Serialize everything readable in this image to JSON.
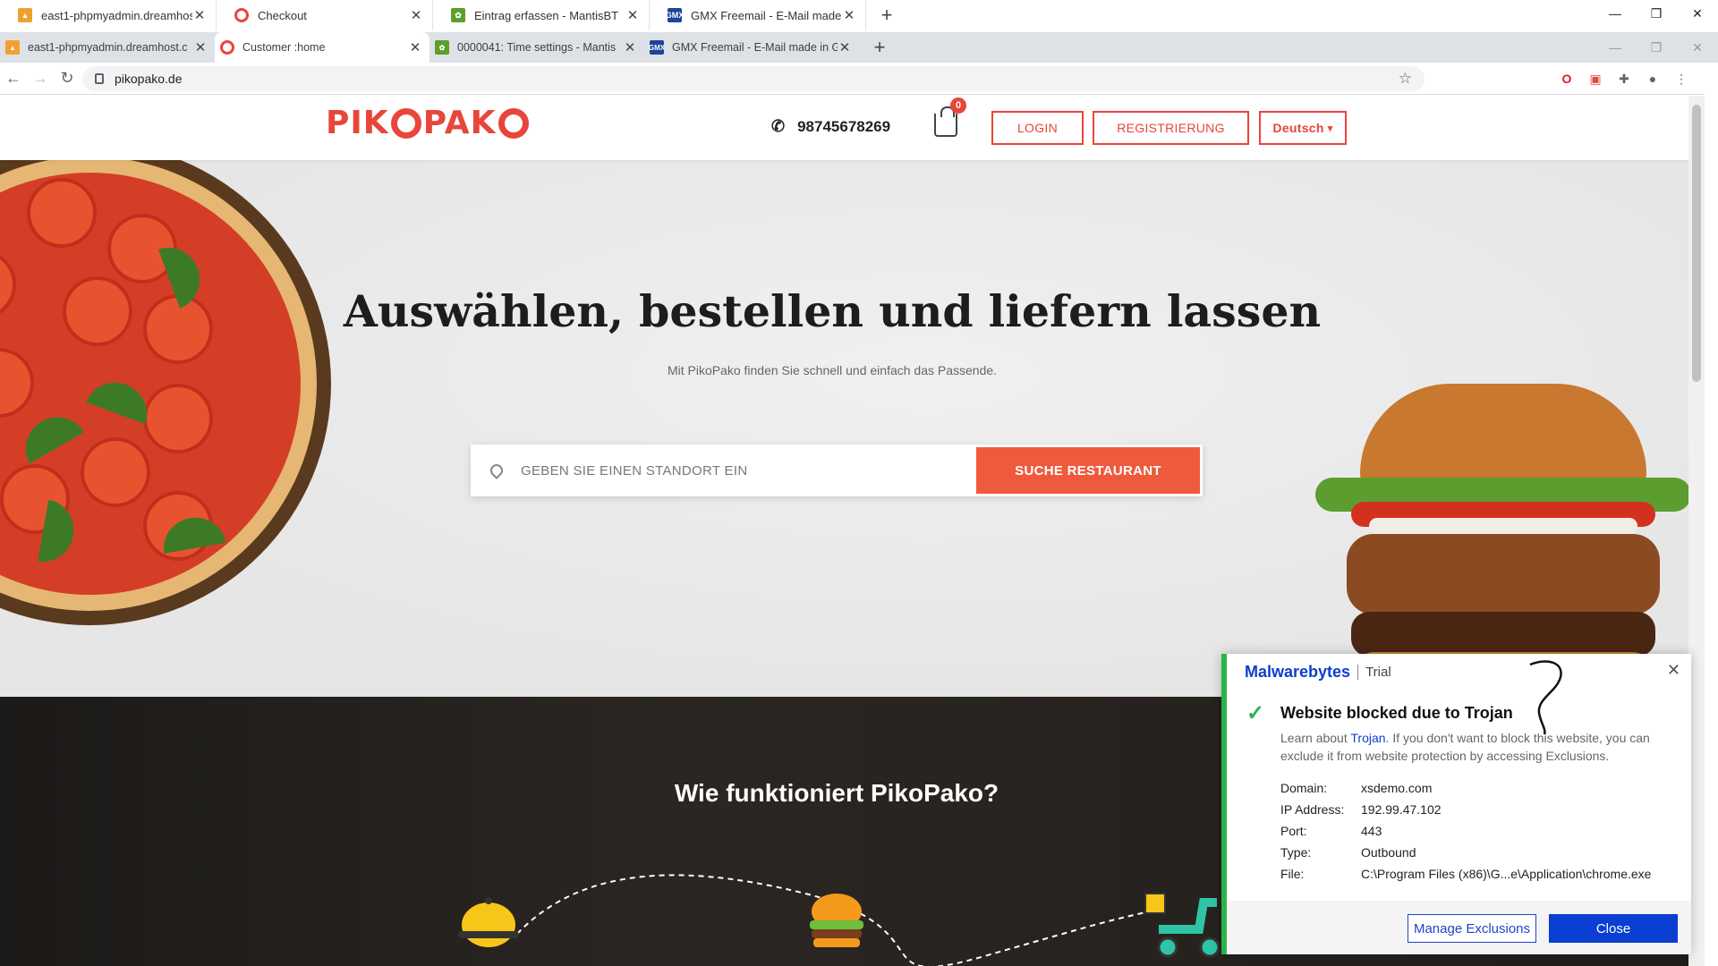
{
  "outer_tabs": [
    {
      "title": "east1-phpmyadmin.dreamhost.c",
      "icon": "phpmyadmin-icon",
      "color": "#f0a030"
    },
    {
      "title": "Checkout",
      "icon": "pikopako-icon",
      "color": "#e8463a"
    },
    {
      "title": "Eintrag erfassen - MantisBT",
      "icon": "mantis-icon",
      "color": "#5aa02c"
    },
    {
      "title": "GMX Freemail - E-Mail made in G",
      "icon": "gmx-icon",
      "color": "#1c449b"
    }
  ],
  "inner_tabs": [
    {
      "title": "east1-phpmyadmin.dreamhost.c",
      "icon": "phpmyadmin-icon",
      "color": "#f0a030",
      "active": false
    },
    {
      "title": "Customer :home",
      "icon": "pikopako-icon",
      "color": "#e8463a",
      "active": true
    },
    {
      "title": "0000041: Time settings - Mantis",
      "icon": "mantis-icon",
      "color": "#5aa02c",
      "active": false
    },
    {
      "title": "GMX Freemail - E-Mail made in G",
      "icon": "gmx-icon",
      "color": "#1c449b",
      "active": false
    }
  ],
  "favicon_texts": {
    "gmx": "GMX"
  },
  "address": {
    "url": "pikopako.de"
  },
  "site": {
    "logo_left": "PIK",
    "logo_right": "PAK",
    "phone": "98745678269",
    "cart_count": "0",
    "login": "LOGIN",
    "register": "REGISTRIERUNG",
    "language": "Deutsch"
  },
  "hero": {
    "title": "Auswählen, bestellen und liefern lassen",
    "subtitle": "Mit PikoPako finden Sie schnell und einfach das Passende.",
    "search_placeholder": "GEBEN SIE EINEN STANDORT EIN",
    "search_button": "SUCHE RESTAURANT"
  },
  "how": {
    "title": "Wie funktioniert PikoPako?"
  },
  "malwarebytes": {
    "brand": "Malwarebytes",
    "trial": "Trial",
    "title": "Website blocked due to Trojan",
    "desc_prefix": "Learn about ",
    "desc_link": "Trojan",
    "desc_suffix": ". If you don't want to block this website, you can exclude it from website protection by accessing Exclusions.",
    "details": [
      {
        "key": "Domain:",
        "value": "xsdemo.com"
      },
      {
        "key": "IP Address:",
        "value": "192.99.47.102"
      },
      {
        "key": "Port:",
        "value": "443"
      },
      {
        "key": "Type:",
        "value": "Outbound"
      },
      {
        "key": "File:",
        "value": "C:\\Program Files (x86)\\G...e\\Application\\chrome.exe"
      }
    ],
    "manage_button": "Manage Exclusions",
    "close_button": "Close"
  },
  "colors": {
    "brand": "#e8463a",
    "search_button": "#ef5a3c",
    "mb_accent": "#2bb34b",
    "mb_blue": "#0a3fd1"
  }
}
